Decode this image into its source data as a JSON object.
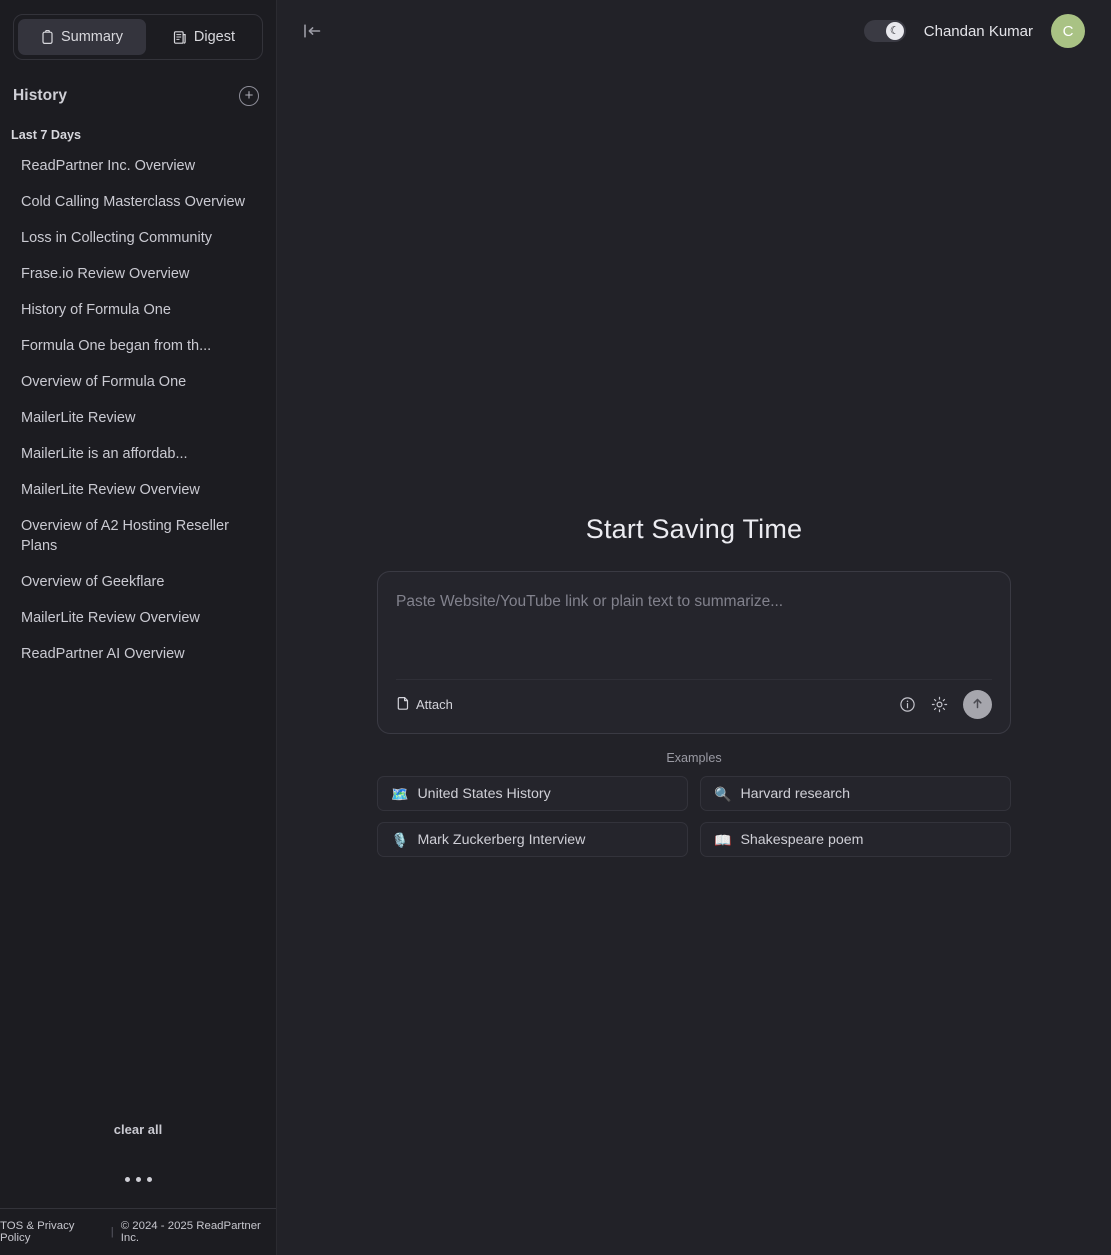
{
  "sidebar": {
    "tabs": [
      {
        "label": "Summary",
        "icon": "clipboard-icon",
        "active": true
      },
      {
        "label": "Digest",
        "icon": "newspaper-icon",
        "active": false
      }
    ],
    "history": {
      "title": "History",
      "new_icon": "plus-circle-icon",
      "group_label": "Last 7 Days",
      "items": [
        "ReadPartner Inc. Overview",
        "Cold Calling Masterclass Overview",
        "Loss in Collecting Community",
        "Frase.io Review Overview",
        "History of Formula One",
        "Formula One began from th...",
        "Overview of Formula One",
        "MailerLite Review",
        "MailerLite is an affordab...",
        "MailerLite Review Overview",
        "Overview of A2 Hosting Reseller Plans",
        "Overview of Geekflare",
        "MailerLite Review Overview",
        "ReadPartner AI Overview"
      ]
    },
    "clear_all_label": "clear all",
    "more_icon": "ellipsis-icon",
    "footer": {
      "tos_label": "TOS & Privacy Policy",
      "divider": "|",
      "copyright": "© 2024 - 2025 ReadPartner Inc."
    }
  },
  "topbar": {
    "collapse_icon": "collapse-sidebar-icon",
    "theme_toggle": {
      "icon": "moon-icon",
      "state": "dark"
    },
    "user_name": "Chandan Kumar",
    "avatar_initial": "C",
    "avatar_color": "#a9c284"
  },
  "main": {
    "hero_title": "Start Saving Time",
    "composer": {
      "placeholder": "Paste Website/YouTube link or plain text to summarize...",
      "value": "",
      "attach_label": "Attach",
      "attach_icon": "attach-icon",
      "info_icon": "info-circle-icon",
      "settings_icon": "gear-icon",
      "send_icon": "arrow-up-icon"
    },
    "examples": {
      "label": "Examples",
      "items": [
        {
          "emoji": "🗺️",
          "label": "United States History",
          "icon": "map-icon"
        },
        {
          "emoji": "🔍",
          "label": "Harvard research",
          "icon": "magnifier-icon"
        },
        {
          "emoji": "🎙️",
          "label": "Mark Zuckerberg Interview",
          "icon": "microphone-icon"
        },
        {
          "emoji": "📖",
          "label": "Shakespeare poem",
          "icon": "open-book-icon"
        }
      ]
    }
  }
}
